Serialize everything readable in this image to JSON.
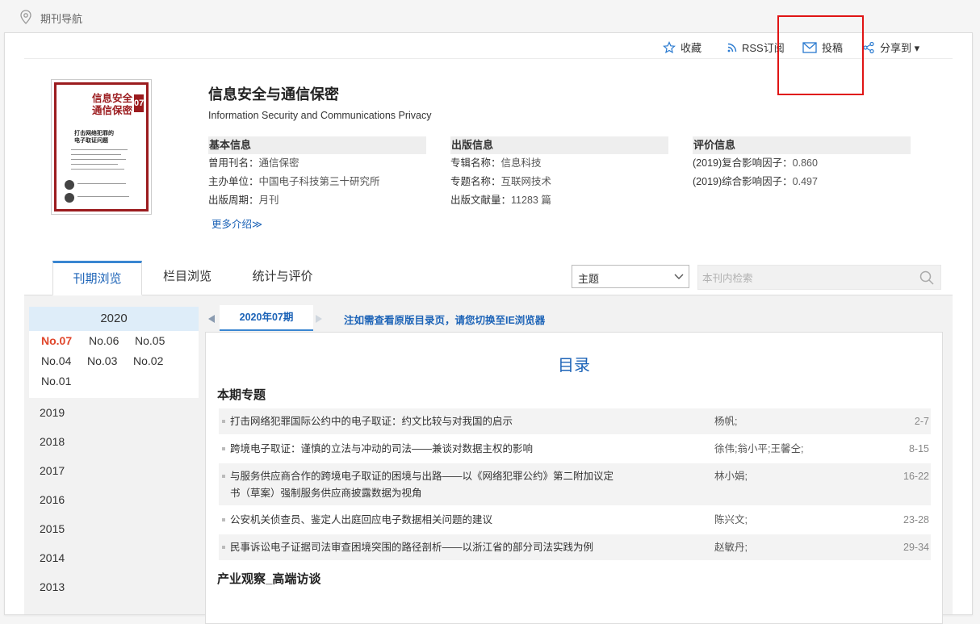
{
  "nav": {
    "label": "期刊导航"
  },
  "actions": {
    "favorite": "收藏",
    "rss": "RSS订阅",
    "submit": "投稿",
    "share": "分享到 ▾"
  },
  "cover": {
    "title_line1": "信息安全",
    "title_line2": "通信保密",
    "issue_num": "07",
    "headline_line1": "打击网络犯罪的",
    "headline_line2": "电子取证问题"
  },
  "journal": {
    "title": "信息安全与通信保密",
    "english": "Information Security and Communications Privacy"
  },
  "basic": {
    "head": "基本信息",
    "rows": [
      {
        "k": "曾用刊名：",
        "v": "通信保密"
      },
      {
        "k": "主办单位：",
        "v": "中国电子科技第三十研究所"
      },
      {
        "k": "出版周期：",
        "v": "月刊"
      }
    ]
  },
  "pub": {
    "head": "出版信息",
    "rows": [
      {
        "k": "专辑名称：",
        "v": "信息科技"
      },
      {
        "k": "专题名称：",
        "v": "互联网技术"
      },
      {
        "k": "出版文献量：",
        "v": "11283 篇"
      }
    ]
  },
  "eval": {
    "head": "评价信息",
    "rows": [
      {
        "k": "(2019)复合影响因子：",
        "v": "0.860"
      },
      {
        "k": "(2019)综合影响因子：",
        "v": "0.497"
      }
    ]
  },
  "more_link": "更多介绍≫",
  "tabs": [
    "刊期浏览",
    "栏目浏览",
    "统计与评价"
  ],
  "search": {
    "select_value": "主题",
    "placeholder": "本刊内检索"
  },
  "years": {
    "current": "2020",
    "issues": [
      "No.07",
      "No.06",
      "No.05",
      "No.04",
      "No.03",
      "No.02",
      "No.01"
    ],
    "others": [
      "2019",
      "2018",
      "2017",
      "2016",
      "2015",
      "2014",
      "2013"
    ]
  },
  "issuebar": {
    "current": "2020年07期",
    "note": "注如需查看原版目录页，请您切换至IE浏览器"
  },
  "toc": {
    "title": "目录",
    "sections": [
      {
        "name": "本期专题",
        "articles": [
          {
            "title": "打击网络犯罪国际公约中的电子取证：约文比较与对我国的启示",
            "title2": "",
            "authors": "杨帆;",
            "pages": "2-7"
          },
          {
            "title": "跨境电子取证：谨慎的立法与冲动的司法——兼谈对数据主权的影响",
            "title2": "",
            "authors": "徐伟;翁小平;王馨仝;",
            "pages": "8-15"
          },
          {
            "title": "与服务供应商合作的跨境电子取证的困境与出路——以《网络犯罪公约》第二附加议定",
            "title2": "书（草案）强制服务供应商披露数据为视角",
            "authors": "林小娟;",
            "pages": "16-22"
          },
          {
            "title": "公安机关侦查员、鉴定人出庭回应电子数据相关问题的建议",
            "title2": "",
            "authors": "陈兴文;",
            "pages": "23-28"
          },
          {
            "title": "民事诉讼电子证据司法审查困境突围的路径剖析——以浙江省的部分司法实践为例",
            "title2": "",
            "authors": "赵敏丹;",
            "pages": "29-34"
          }
        ]
      },
      {
        "name": "产业观察_高端访谈",
        "articles": []
      }
    ]
  }
}
